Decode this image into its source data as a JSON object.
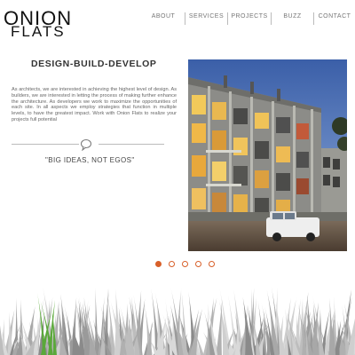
{
  "brand": {
    "logo_line1": "ONION",
    "logo_line2": "FLATS"
  },
  "nav": {
    "items": [
      {
        "label": "ABOUT"
      },
      {
        "label": "SERVICES"
      },
      {
        "label": "PROJECTS"
      },
      {
        "label": "BUZZ"
      },
      {
        "label": "CONTACT"
      }
    ]
  },
  "main": {
    "headline": "DESIGN-BUILD-DEVELOP",
    "body": "As architects, we are interested in achieving the highest level of design.  As builders, we are interested in letting the process of making further enhance the architecture.  As developers we work to maximize the opportunities of each site.  In all aspects we employ strategies that function in multiple levels, to have the greatest impact.  Work with Onion Flats to realize your projects full potential",
    "tagline": "\"BIG IDEAS, NOT EGOS\""
  },
  "slider": {
    "total": 5,
    "active_index": 0
  },
  "colors": {
    "accent": "#d8602a",
    "grass_green": "#5aa83a"
  }
}
